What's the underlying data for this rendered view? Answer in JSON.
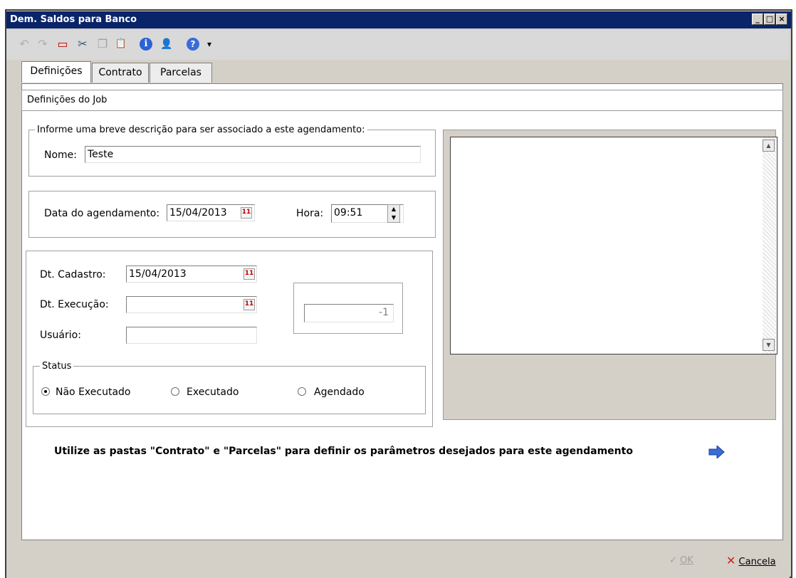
{
  "window": {
    "title": "Dem. Saldos para Banco",
    "min": "_",
    "max": "□",
    "close": "×"
  },
  "toolbar": {
    "items": [
      {
        "name": "undo-icon",
        "glyph": "↶"
      },
      {
        "name": "redo-icon",
        "glyph": "↷"
      },
      {
        "name": "new-doc-icon",
        "glyph": "▭"
      },
      {
        "name": "cut-icon",
        "glyph": "✂"
      },
      {
        "name": "copy-icon",
        "glyph": "❐"
      },
      {
        "name": "paste-icon",
        "glyph": "📋"
      },
      {
        "name": "info-icon",
        "glyph": "ℹ"
      },
      {
        "name": "user-icon",
        "glyph": "👤"
      },
      {
        "name": "help-icon",
        "glyph": "?"
      },
      {
        "name": "dropdown-arrow-icon",
        "glyph": "▾"
      }
    ]
  },
  "tabs": [
    "Definições",
    "Contrato",
    "Parcelas"
  ],
  "job": {
    "header": "Definições do Job"
  },
  "description": {
    "legend": "Informe uma breve descrição para ser associado a este agendamento:",
    "name_label": "Nome:",
    "name_value": "Teste"
  },
  "schedule": {
    "date_label": "Data do agendamento:",
    "date_value": "15/04/2013",
    "hour_label": "Hora:",
    "hour_value": "09:51"
  },
  "details": {
    "cadastro_label": "Dt. Cadastro:",
    "cadastro_value": "15/04/2013",
    "execucao_label": "Dt. Execução:",
    "execucao_value": "",
    "usuario_label": "Usuário:",
    "usuario_value": "",
    "id_value": "-1"
  },
  "status": {
    "legend": "Status",
    "options": [
      "Não Executado",
      "Executado",
      "Agendado"
    ],
    "selected": "Não Executado"
  },
  "hint": "Utilize as pastas \"Contrato\" e \"Parcelas\" para definir os parâmetros desejados para este agendamento",
  "footer": {
    "ok_label": "OK",
    "cancel_label": "Cancela"
  },
  "colors": {
    "titlebar": "#0a246a",
    "hint_arrow": "#3a6cd8",
    "cancel_icon": "#d0201a"
  }
}
